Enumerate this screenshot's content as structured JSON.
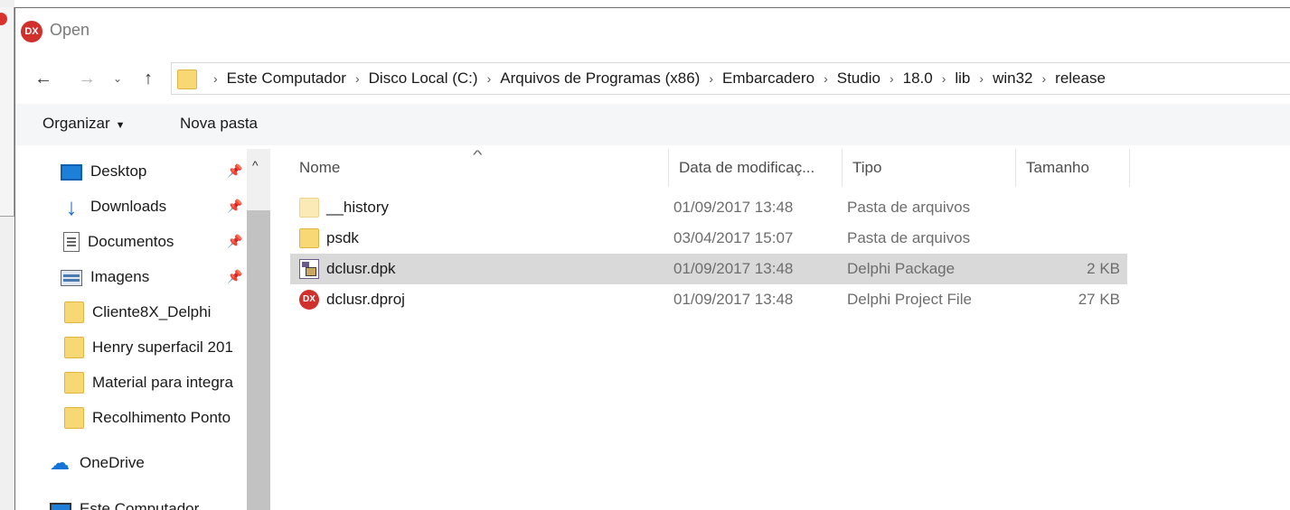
{
  "window": {
    "title": "Open",
    "app_icon_label": "DX"
  },
  "navigation": {
    "back": "←",
    "forward": "→",
    "recent": "⌄",
    "up": "↑"
  },
  "breadcrumb": {
    "separator": "›",
    "items": [
      "Este Computador",
      "Disco Local (C:)",
      "Arquivos de Programas (x86)",
      "Embarcadero",
      "Studio",
      "18.0",
      "lib",
      "win32",
      "release"
    ]
  },
  "toolbar": {
    "organize_label": "Organizar",
    "organize_caret": "▼",
    "new_folder_label": "Nova pasta"
  },
  "sidebar": {
    "pin_glyph": "📌",
    "scroll_up": "^",
    "items": [
      {
        "label": "Desktop",
        "icon": "desktop-icon"
      },
      {
        "label": "Downloads",
        "icon": "download-icon"
      },
      {
        "label": "Documentos",
        "icon": "documents-icon"
      },
      {
        "label": "Imagens",
        "icon": "images-icon"
      },
      {
        "label": "Cliente8X_Delphi",
        "icon": "folder-icon"
      },
      {
        "label": "Henry superfacil 201",
        "icon": "folder-icon"
      },
      {
        "label": "Material para integra",
        "icon": "folder-icon"
      },
      {
        "label": "Recolhimento Ponto",
        "icon": "folder-icon"
      },
      {
        "label": "OneDrive",
        "icon": "onedrive-icon"
      },
      {
        "label": "Este Computador",
        "icon": "computer-icon"
      }
    ]
  },
  "columns": {
    "sort_indicator": "^",
    "name": "Nome",
    "date": "Data de modificaç...",
    "type": "Tipo",
    "size": "Tamanho"
  },
  "files": [
    {
      "name": "__history",
      "date": "01/09/2017 13:48",
      "type": "Pasta de arquivos",
      "size": "",
      "icon": "folder-light-icon"
    },
    {
      "name": "psdk",
      "date": "03/04/2017 15:07",
      "type": "Pasta de arquivos",
      "size": "",
      "icon": "folder-icon"
    },
    {
      "name": "dclusr.dpk",
      "date": "01/09/2017 13:48",
      "type": "Delphi Package",
      "size": "2 KB",
      "icon": "dpk-file-icon",
      "selected": true
    },
    {
      "name": "dclusr.dproj",
      "date": "01/09/2017 13:48",
      "type": "Delphi Project File",
      "size": "27 KB",
      "icon": "dproj-file-icon"
    }
  ],
  "colors": {
    "selection": "#d9d9d9",
    "toolbar_bg": "#f5f6f7",
    "folder": "#f8d775",
    "delphi_red": "#d0312d"
  }
}
